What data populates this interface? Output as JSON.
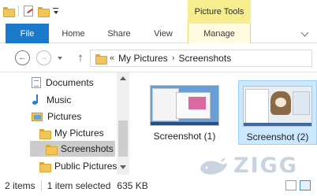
{
  "titlebar": {
    "context_tab": "Picture Tools",
    "quick_access": [
      "folder-icon",
      "properties-icon",
      "new-folder-icon",
      "customize-dropdown"
    ]
  },
  "ribbon": {
    "tabs": [
      {
        "label": "File",
        "active": true
      },
      {
        "label": "Home"
      },
      {
        "label": "Share"
      },
      {
        "label": "View"
      },
      {
        "label": "Manage"
      }
    ]
  },
  "address": {
    "overflow": "«",
    "path": [
      "My Pictures",
      "Screenshots"
    ]
  },
  "nav_tree": [
    {
      "label": "Documents",
      "icon": "documents-icon"
    },
    {
      "label": "Music",
      "icon": "music-icon"
    },
    {
      "label": "Pictures",
      "icon": "pictures-icon"
    },
    {
      "label": "My Pictures",
      "icon": "folder-icon"
    },
    {
      "label": "Screenshots",
      "icon": "folder-icon",
      "selected": true
    },
    {
      "label": "Public Pictures",
      "icon": "folder-icon"
    }
  ],
  "files": [
    {
      "name": "Screenshot (1)",
      "selected": false
    },
    {
      "name": "Screenshot (2)",
      "selected": true
    }
  ],
  "status": {
    "items": "2 items",
    "selection": "1 item selected",
    "size": "635 KB"
  },
  "watermark": "ZIGG",
  "colors": {
    "file_tab": "#1979ca",
    "context_tab": "#f6ee8e",
    "selection": "#cce8ff"
  }
}
